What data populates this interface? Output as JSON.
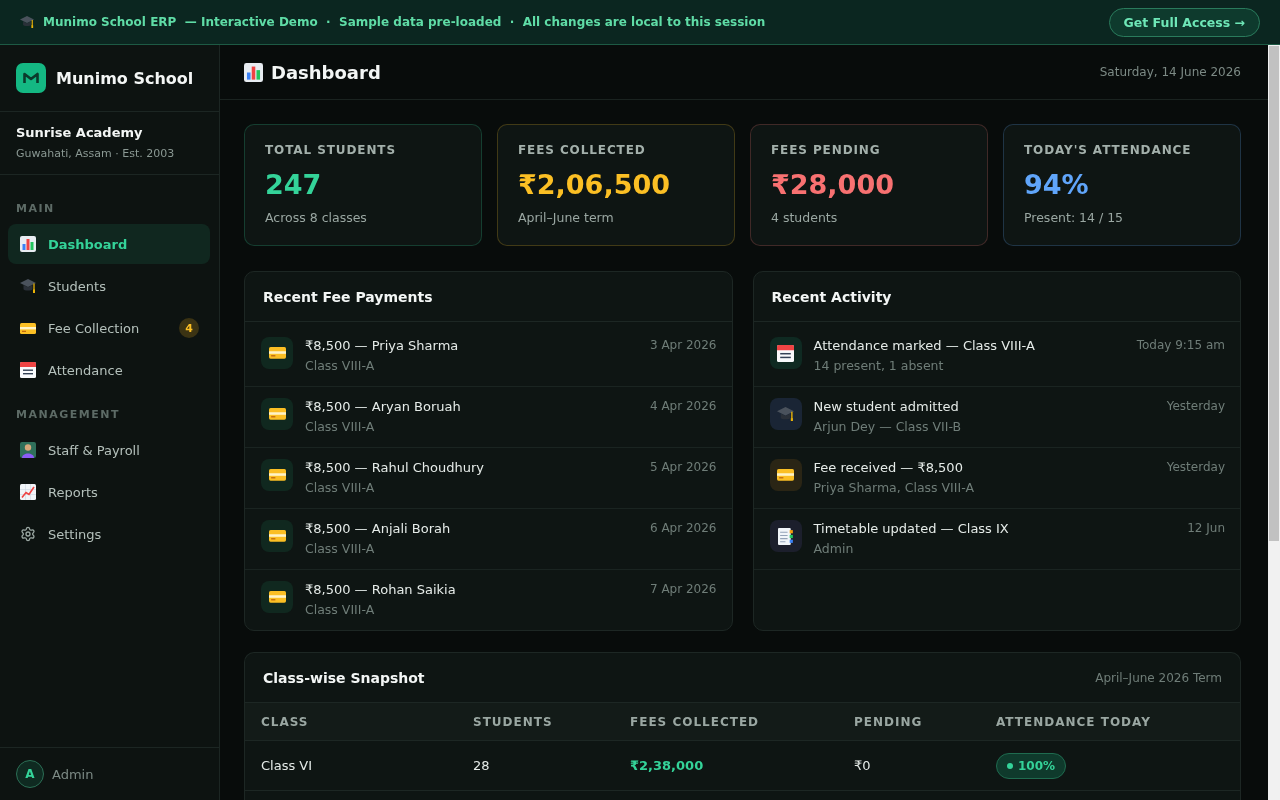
{
  "banner": {
    "text": "Munimo School ERP  — Interactive Demo  ·  Sample data pre-loaded  ·  All changes are local to this session",
    "button": "Get Full Access →"
  },
  "sidebar": {
    "brand": "Munimo School",
    "school": {
      "name": "Sunrise Academy",
      "subtitle": "Guwahati, Assam · Est. 2003"
    },
    "sections": [
      {
        "label": "MAIN",
        "items": [
          {
            "label": "Dashboard",
            "kind": "chart",
            "selected": true
          },
          {
            "label": "Students",
            "kind": "cap",
            "selected": false
          },
          {
            "label": "Fee Collection",
            "kind": "card",
            "selected": false,
            "badge": "4"
          },
          {
            "label": "Attendance",
            "kind": "calendar",
            "selected": false
          }
        ]
      },
      {
        "label": "MANAGEMENT",
        "items": [
          {
            "label": "Staff & Payroll",
            "kind": "person",
            "selected": false
          },
          {
            "label": "Reports",
            "kind": "trend",
            "selected": false
          },
          {
            "label": "Settings",
            "kind": "gear",
            "selected": false
          }
        ]
      }
    ],
    "user": {
      "initial": "A",
      "name": "Admin"
    }
  },
  "header": {
    "title": "Dashboard",
    "date": "Saturday, 14 June 2026"
  },
  "stats": [
    {
      "label": "TOTAL STUDENTS",
      "value": "247",
      "note": "Across 8 classes",
      "color": "#34d399"
    },
    {
      "label": "FEES COLLECTED",
      "value": "₹2,06,500",
      "note": "April–June term",
      "color": "#fbbf24"
    },
    {
      "label": "FEES PENDING",
      "value": "₹28,000",
      "note": "4 students",
      "color": "#f87171"
    },
    {
      "label": "TODAY'S ATTENDANCE",
      "value": "94%",
      "note": "Present: 14 / 15",
      "color": "#60a5fa"
    }
  ],
  "fee_payments": {
    "title": "Recent Fee Payments",
    "rows": [
      {
        "title": "₹8,500 — Priya Sharma",
        "subtitle": "Class VIII-A",
        "date": "3 Apr 2026"
      },
      {
        "title": "₹8,500 — Aryan Boruah",
        "subtitle": "Class VIII-A",
        "date": "4 Apr 2026"
      },
      {
        "title": "₹8,500 — Rahul Choudhury",
        "subtitle": "Class VIII-A",
        "date": "5 Apr 2026"
      },
      {
        "title": "₹8,500 — Anjali Borah",
        "subtitle": "Class VIII-A",
        "date": "6 Apr 2026"
      },
      {
        "title": "₹8,500 — Rohan Saikia",
        "subtitle": "Class VIII-A",
        "date": "7 Apr 2026"
      }
    ]
  },
  "activity": {
    "title": "Recent Activity",
    "items": [
      {
        "kind": "calendar",
        "color": "#0f2a22",
        "title": "Attendance marked — Class VIII-A",
        "subtitle": "14 present, 1 absent",
        "time": "Today 9:15 am"
      },
      {
        "kind": "cap",
        "color": "#1a2535",
        "title": "New student admitted",
        "subtitle": "Arjun Dey — Class VII-B",
        "time": "Yesterday"
      },
      {
        "kind": "card",
        "color": "#2a2515",
        "title": "Fee received — ₹8,500",
        "subtitle": "Priya Sharma, Class VIII-A",
        "time": "Yesterday"
      },
      {
        "kind": "document",
        "color": "#1c1f2c",
        "title": "Timetable updated — Class IX",
        "subtitle": "Admin",
        "time": "12 Jun"
      }
    ]
  },
  "snapshot": {
    "title": "Class-wise Snapshot",
    "term": "April–June 2026 Term",
    "columns": [
      "CLASS",
      "STUDENTS",
      "FEES COLLECTED",
      "PENDING",
      "ATTENDANCE TODAY"
    ],
    "rows": [
      {
        "class": "Class VI",
        "students": "28",
        "fees_collected": "₹2,38,000",
        "pending": "₹0",
        "attendance": "100%"
      }
    ]
  }
}
